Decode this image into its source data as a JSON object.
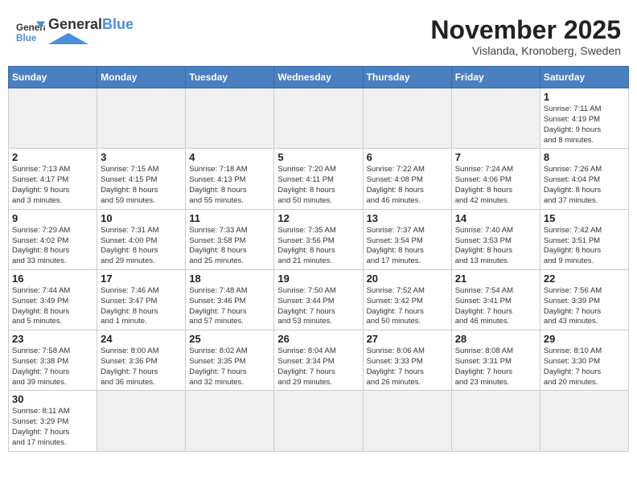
{
  "header": {
    "logo_general": "General",
    "logo_blue": "Blue",
    "month_title": "November 2025",
    "subtitle": "Vislanda, Kronoberg, Sweden"
  },
  "weekdays": [
    "Sunday",
    "Monday",
    "Tuesday",
    "Wednesday",
    "Thursday",
    "Friday",
    "Saturday"
  ],
  "days": [
    {
      "num": "",
      "info": ""
    },
    {
      "num": "",
      "info": ""
    },
    {
      "num": "",
      "info": ""
    },
    {
      "num": "",
      "info": ""
    },
    {
      "num": "",
      "info": ""
    },
    {
      "num": "",
      "info": ""
    },
    {
      "num": "1",
      "info": "Sunrise: 7:11 AM\nSunset: 4:19 PM\nDaylight: 9 hours\nand 8 minutes."
    },
    {
      "num": "2",
      "info": "Sunrise: 7:13 AM\nSunset: 4:17 PM\nDaylight: 9 hours\nand 3 minutes."
    },
    {
      "num": "3",
      "info": "Sunrise: 7:15 AM\nSunset: 4:15 PM\nDaylight: 8 hours\nand 59 minutes."
    },
    {
      "num": "4",
      "info": "Sunrise: 7:18 AM\nSunset: 4:13 PM\nDaylight: 8 hours\nand 55 minutes."
    },
    {
      "num": "5",
      "info": "Sunrise: 7:20 AM\nSunset: 4:11 PM\nDaylight: 8 hours\nand 50 minutes."
    },
    {
      "num": "6",
      "info": "Sunrise: 7:22 AM\nSunset: 4:08 PM\nDaylight: 8 hours\nand 46 minutes."
    },
    {
      "num": "7",
      "info": "Sunrise: 7:24 AM\nSunset: 4:06 PM\nDaylight: 8 hours\nand 42 minutes."
    },
    {
      "num": "8",
      "info": "Sunrise: 7:26 AM\nSunset: 4:04 PM\nDaylight: 8 hours\nand 37 minutes."
    },
    {
      "num": "9",
      "info": "Sunrise: 7:29 AM\nSunset: 4:02 PM\nDaylight: 8 hours\nand 33 minutes."
    },
    {
      "num": "10",
      "info": "Sunrise: 7:31 AM\nSunset: 4:00 PM\nDaylight: 8 hours\nand 29 minutes."
    },
    {
      "num": "11",
      "info": "Sunrise: 7:33 AM\nSunset: 3:58 PM\nDaylight: 8 hours\nand 25 minutes."
    },
    {
      "num": "12",
      "info": "Sunrise: 7:35 AM\nSunset: 3:56 PM\nDaylight: 8 hours\nand 21 minutes."
    },
    {
      "num": "13",
      "info": "Sunrise: 7:37 AM\nSunset: 3:54 PM\nDaylight: 8 hours\nand 17 minutes."
    },
    {
      "num": "14",
      "info": "Sunrise: 7:40 AM\nSunset: 3:53 PM\nDaylight: 8 hours\nand 13 minutes."
    },
    {
      "num": "15",
      "info": "Sunrise: 7:42 AM\nSunset: 3:51 PM\nDaylight: 8 hours\nand 9 minutes."
    },
    {
      "num": "16",
      "info": "Sunrise: 7:44 AM\nSunset: 3:49 PM\nDaylight: 8 hours\nand 5 minutes."
    },
    {
      "num": "17",
      "info": "Sunrise: 7:46 AM\nSunset: 3:47 PM\nDaylight: 8 hours\nand 1 minute."
    },
    {
      "num": "18",
      "info": "Sunrise: 7:48 AM\nSunset: 3:46 PM\nDaylight: 7 hours\nand 57 minutes."
    },
    {
      "num": "19",
      "info": "Sunrise: 7:50 AM\nSunset: 3:44 PM\nDaylight: 7 hours\nand 53 minutes."
    },
    {
      "num": "20",
      "info": "Sunrise: 7:52 AM\nSunset: 3:42 PM\nDaylight: 7 hours\nand 50 minutes."
    },
    {
      "num": "21",
      "info": "Sunrise: 7:54 AM\nSunset: 3:41 PM\nDaylight: 7 hours\nand 46 minutes."
    },
    {
      "num": "22",
      "info": "Sunrise: 7:56 AM\nSunset: 3:39 PM\nDaylight: 7 hours\nand 43 minutes."
    },
    {
      "num": "23",
      "info": "Sunrise: 7:58 AM\nSunset: 3:38 PM\nDaylight: 7 hours\nand 39 minutes."
    },
    {
      "num": "24",
      "info": "Sunrise: 8:00 AM\nSunset: 3:36 PM\nDaylight: 7 hours\nand 36 minutes."
    },
    {
      "num": "25",
      "info": "Sunrise: 8:02 AM\nSunset: 3:35 PM\nDaylight: 7 hours\nand 32 minutes."
    },
    {
      "num": "26",
      "info": "Sunrise: 8:04 AM\nSunset: 3:34 PM\nDaylight: 7 hours\nand 29 minutes."
    },
    {
      "num": "27",
      "info": "Sunrise: 8:06 AM\nSunset: 3:33 PM\nDaylight: 7 hours\nand 26 minutes."
    },
    {
      "num": "28",
      "info": "Sunrise: 8:08 AM\nSunset: 3:31 PM\nDaylight: 7 hours\nand 23 minutes."
    },
    {
      "num": "29",
      "info": "Sunrise: 8:10 AM\nSunset: 3:30 PM\nDaylight: 7 hours\nand 20 minutes."
    },
    {
      "num": "30",
      "info": "Sunrise: 8:11 AM\nSunset: 3:29 PM\nDaylight: 7 hours\nand 17 minutes."
    }
  ]
}
